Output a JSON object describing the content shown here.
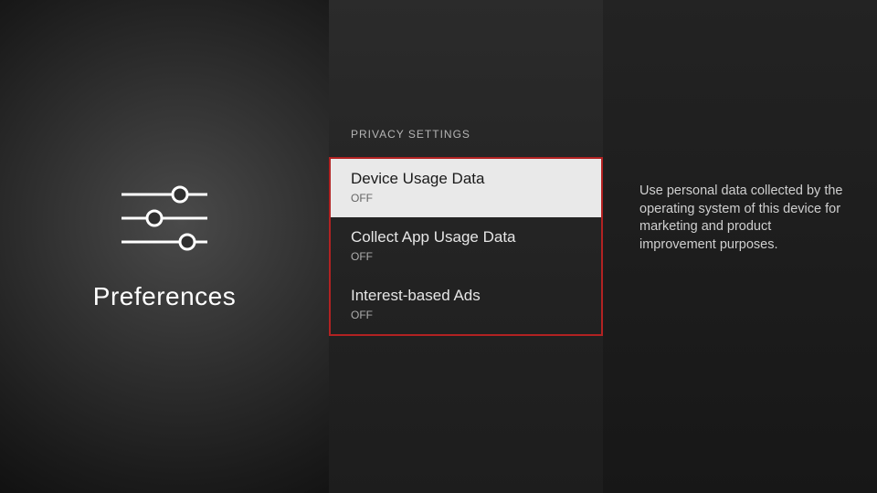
{
  "left": {
    "title": "Preferences"
  },
  "middle": {
    "heading": "PRIVACY SETTINGS",
    "options": [
      {
        "label": "Device Usage Data",
        "value": "OFF"
      },
      {
        "label": "Collect App Usage Data",
        "value": "OFF"
      },
      {
        "label": "Interest-based Ads",
        "value": "OFF"
      }
    ]
  },
  "right": {
    "description": "Use personal data collected by the operating system of this device for marketing and product improvement purposes."
  }
}
